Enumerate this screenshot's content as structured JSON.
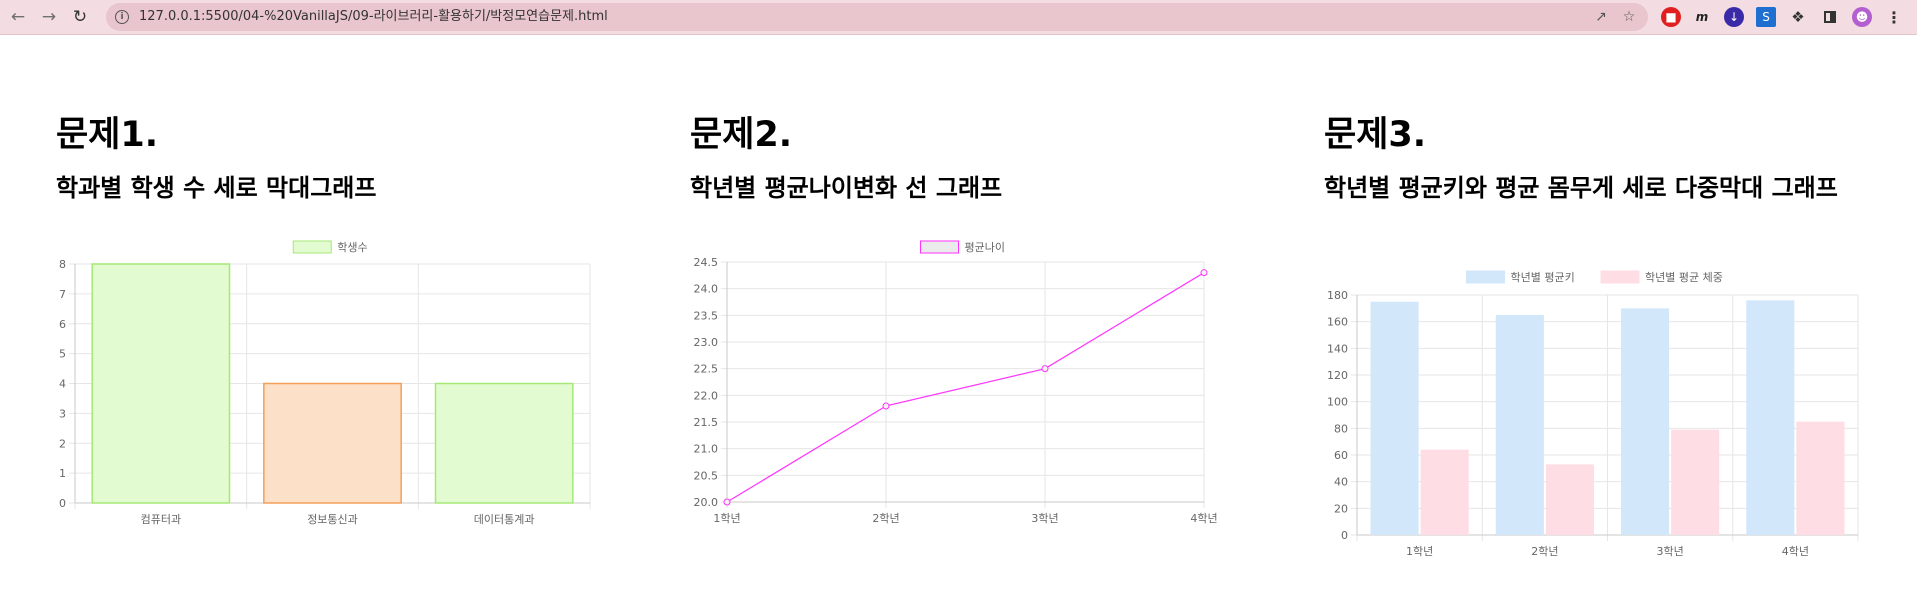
{
  "browser": {
    "url": "127.0.0.1:5500/04-%20VanillaJS/09-라이브러리-활용하기/박정모연습문제.html",
    "icons": [
      "back-arrow-icon",
      "forward-arrow-icon",
      "reload-icon",
      "site-info-icon",
      "share-icon",
      "bookmark-star-icon",
      "extension-icons",
      "puzzle-icon",
      "sidebar-icon",
      "profile-avatar",
      "kebab-menu-icon"
    ]
  },
  "sections": [
    {
      "title": "문제1.",
      "subtitle": "학과별 학생 수 세로 막대그래프"
    },
    {
      "title": "문제2.",
      "subtitle": "학년별 평균나이변화 선 그래프"
    },
    {
      "title": "문제3.",
      "subtitle": "학년별 평균키와 평균 몸무게 세로 다중막대 그래프"
    }
  ],
  "chart_data": [
    {
      "type": "bar",
      "categories": [
        "컴퓨터과",
        "정보통신과",
        "데이터통계과"
      ],
      "series": [
        {
          "name": "학생수",
          "values": [
            8,
            4,
            4
          ]
        }
      ],
      "bar_colors": [
        "#e2fbd0",
        "#fde0c8",
        "#e2fbd0"
      ],
      "bar_borders": [
        "#a6e875",
        "#f2a05a",
        "#a6e875"
      ],
      "legend_color": "#e2fbd0",
      "legend_border": "#a6e875",
      "yticks": [
        "0",
        "1",
        "2",
        "3",
        "4",
        "5",
        "6",
        "7",
        "8"
      ],
      "ylim": [
        0,
        8
      ],
      "legend": "top",
      "grid": true
    },
    {
      "type": "line",
      "categories": [
        "1학년",
        "2학년",
        "3학년",
        "4학년"
      ],
      "series": [
        {
          "name": "평균나이",
          "values": [
            20.0,
            21.8,
            22.5,
            24.3
          ],
          "color": "#ff33ff"
        }
      ],
      "yticks": [
        "20.0",
        "20.5",
        "21.0",
        "21.5",
        "22.0",
        "22.5",
        "23.0",
        "23.5",
        "24.0",
        "24.5"
      ],
      "ylim": [
        20.0,
        24.5
      ],
      "legend": "top",
      "grid": true
    },
    {
      "type": "bar",
      "categories": [
        "1학년",
        "2학년",
        "3학년",
        "4학년"
      ],
      "series": [
        {
          "name": "학년별 평균키",
          "values": [
            175,
            165,
            170,
            176
          ],
          "color": "#d3e7fa"
        },
        {
          "name": "학년별 평균 체중",
          "values": [
            64,
            53,
            79,
            85
          ],
          "color": "#fedee4"
        }
      ],
      "yticks": [
        "0",
        "20",
        "40",
        "60",
        "80",
        "100",
        "120",
        "140",
        "160",
        "180"
      ],
      "ylim": [
        0,
        180
      ],
      "legend": "top",
      "grid": true
    }
  ]
}
